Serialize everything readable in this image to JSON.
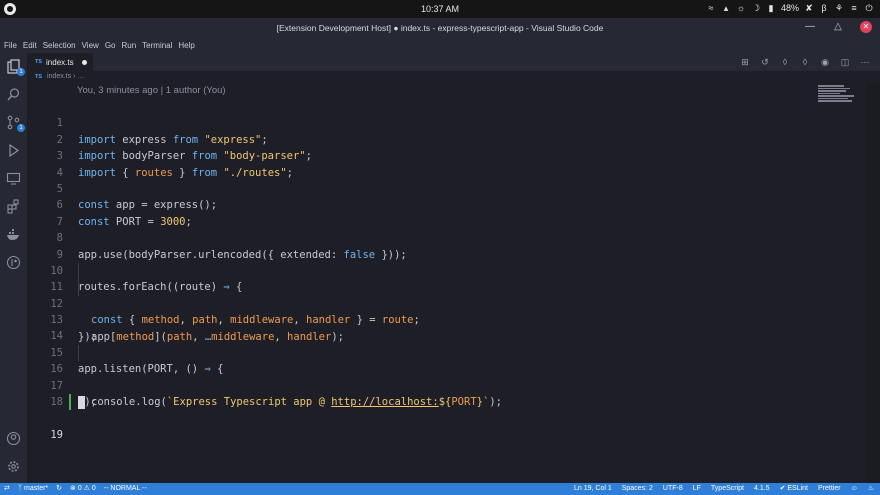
{
  "os_bar": {
    "clock": "10:37 AM",
    "battery": "48%"
  },
  "window": {
    "title": "[Extension Development Host] ● index.ts - express-typescript-app - Visual Studio Code"
  },
  "menu": [
    "File",
    "Edit",
    "Selection",
    "View",
    "Go",
    "Run",
    "Terminal",
    "Help"
  ],
  "activity_bar": {
    "explorer_badge": "1",
    "scm_badge": "1"
  },
  "tab": {
    "lang": "TS",
    "label": "index.ts"
  },
  "breadcrumb": {
    "lang": "TS",
    "file": "index.ts",
    "more": "› …"
  },
  "blame": "You, 3 minutes ago | 1 author (You)",
  "code": {
    "line_numbers": [
      "1",
      "2",
      "3",
      "4",
      "5",
      "6",
      "7",
      "8",
      "9",
      "10",
      "11",
      "12",
      "13",
      "14",
      "15",
      "16",
      "17",
      "18",
      "19"
    ],
    "l1": {
      "kw1": "import",
      "t1": " express ",
      "kw2": "from",
      "t2": " ",
      "s1": "\"express\"",
      "t3": ";"
    },
    "l2": {
      "kw1": "import",
      "t1": " bodyParser ",
      "kw2": "from",
      "t2": " ",
      "s1": "\"body-parser\"",
      "t3": ";"
    },
    "l3": {
      "kw1": "import",
      "t1": " { ",
      "id1": "routes",
      "t2": " } ",
      "kw2": "from",
      "t3": " ",
      "s1": "\"./routes\"",
      "t4": ";"
    },
    "l5": {
      "kw1": "const",
      "t1": " app = express();"
    },
    "l6": {
      "kw1": "const",
      "t1": " PORT = ",
      "n1": "3000",
      "t2": ";"
    },
    "l8": {
      "t1": "app.use(bodyParser.urlencoded({ extended: ",
      "kw1": "false",
      "t2": " }));"
    },
    "l10": {
      "t1": "routes.forEach((route) ",
      "kw1": "⇒",
      "t2": " {"
    },
    "l11": {
      "kw1": "const",
      "t1": " { ",
      "id1": "method",
      "t2": ", ",
      "id2": "path",
      "t3": ", ",
      "id3": "middleware",
      "t4": ", ",
      "id4": "handler",
      "t5": " } = ",
      "id5": "route",
      "t6": ";"
    },
    "l12": {
      "t1": "app[",
      "id1": "method",
      "t2": "](",
      "id2": "path",
      "t3": ", ",
      "kw1": "…",
      "id3": "middleware",
      "t4": ", ",
      "id4": "handler",
      "t5": ");"
    },
    "l13": {
      "t1": "});"
    },
    "l15": {
      "t1": "app.listen(PORT, () ",
      "kw1": "⇒",
      "t2": " {"
    },
    "l16": {
      "t1": "console.log(",
      "s1": "`Express Typescript app @ ",
      "lnk": "http://localhost:",
      "s2": "${",
      "id1": "PORT",
      "s3": "}`",
      "t2": ");"
    },
    "l17": {
      "t1": "});"
    }
  },
  "status_bar": {
    "branch": "master*",
    "problems": "⊗ 0 ⚠ 0",
    "vim_mode": "-- NORMAL --",
    "cursor_pos": "Ln 19, Col 1",
    "spaces": "Spaces: 2",
    "encoding": "UTF-8",
    "eol": "LF",
    "language": "TypeScript",
    "ts_version": "4.1.5",
    "eslint": "✔ ESLint",
    "prettier": "Prettier"
  },
  "colors": {
    "accent": "#2f7fd8",
    "keyword": "#6fb3f0",
    "string": "#f0c674",
    "identifier": "#f09a52",
    "git_added": "#4caf50"
  }
}
